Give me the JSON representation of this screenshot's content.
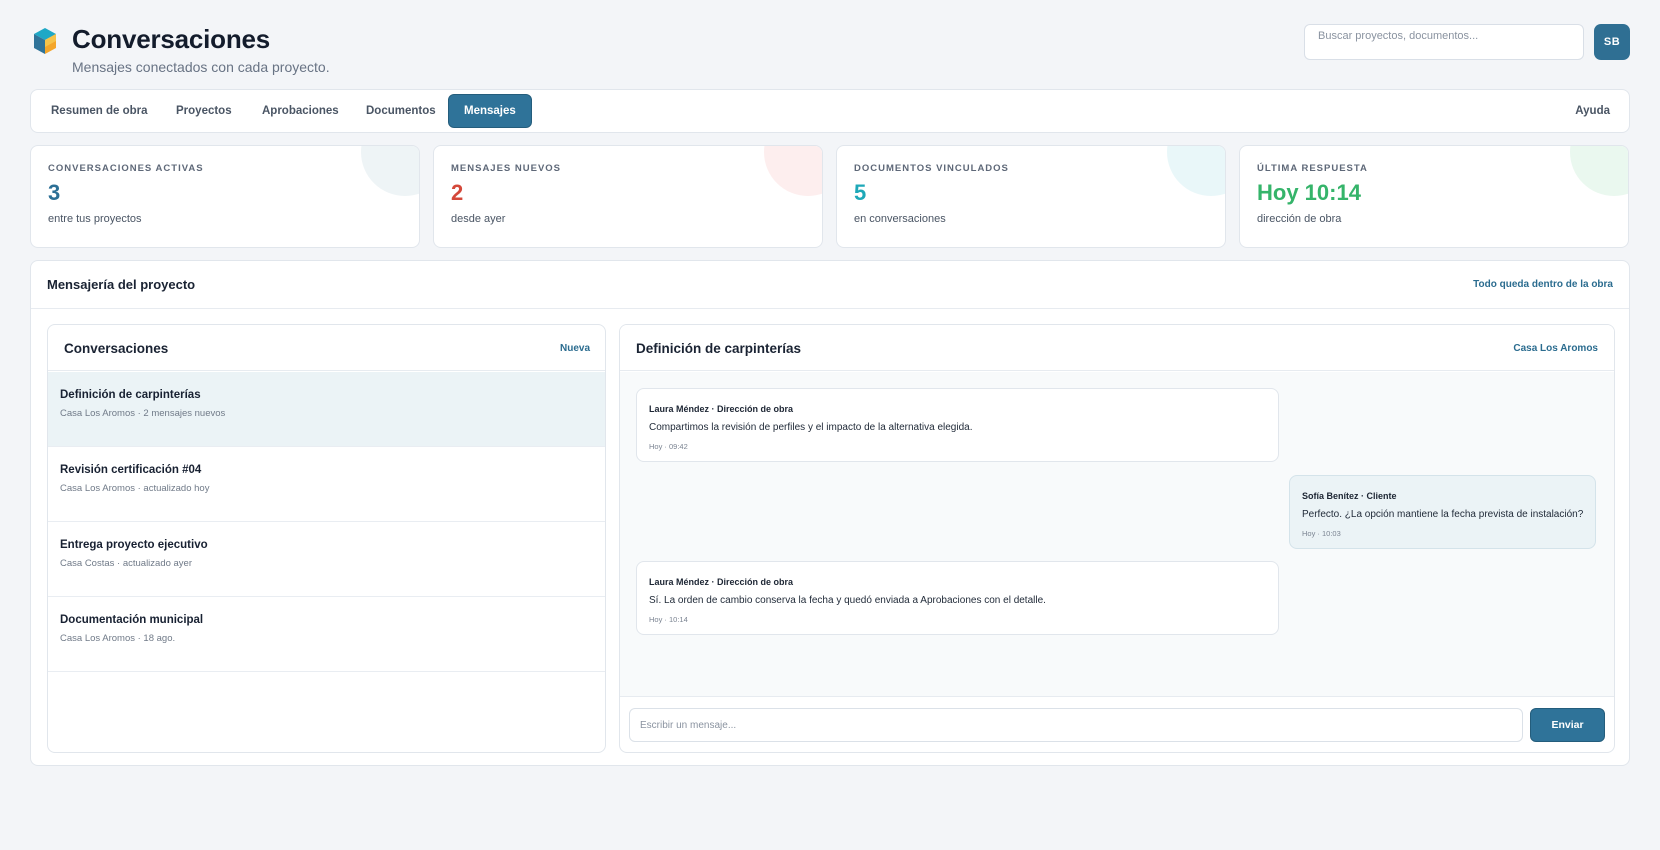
{
  "header": {
    "title": "Conversaciones",
    "subtitle": "Mensajes conectados con cada proyecto.",
    "search_placeholder": "Buscar proyectos, documentos...",
    "avatar_initials": "SB",
    "logo_icon": "cube-logo-icon"
  },
  "nav": {
    "tabs": [
      {
        "label": "Resumen de obra",
        "active": false
      },
      {
        "label": "Proyectos",
        "active": false
      },
      {
        "label": "Aprobaciones",
        "active": false
      },
      {
        "label": "Documentos",
        "active": false
      },
      {
        "label": "Mensajes",
        "active": true
      }
    ],
    "help": "Ayuda"
  },
  "stats": [
    {
      "label": "Conversaciones activas",
      "value": "3",
      "sub": "entre tus proyectos",
      "color": "#2c6f95",
      "deco": "#eef4f6"
    },
    {
      "label": "Mensajes nuevos",
      "value": "2",
      "sub": "desde ayer",
      "color": "#d4483a",
      "deco": "#fdeeee"
    },
    {
      "label": "Documentos vinculados",
      "value": "5",
      "sub": "en conversaciones",
      "color": "#1ea8b8",
      "deco": "#e9f7f9"
    },
    {
      "label": "Última respuesta",
      "value": "Hoy 10:14",
      "sub": "dirección de obra",
      "color": "#35b46a",
      "deco": "#eaf8ef"
    }
  ],
  "panel": {
    "title": "Mensajería del proyecto",
    "note": "Todo queda dentro de la obra"
  },
  "conversations": {
    "title": "Conversaciones",
    "new_label": "Nueva",
    "items": [
      {
        "title": "Definición de carpinterías",
        "meta": "Casa Los Aromos · 2 mensajes nuevos",
        "active": true
      },
      {
        "title": "Revisión certificación #04",
        "meta": "Casa Los Aromos · actualizado hoy",
        "active": false
      },
      {
        "title": "Entrega proyecto ejecutivo",
        "meta": "Casa Costas · actualizado ayer",
        "active": false
      },
      {
        "title": "Documentación municipal",
        "meta": "Casa Los Aromos · 18 ago.",
        "active": false
      }
    ]
  },
  "chat": {
    "title": "Definición de carpinterías",
    "project": "Casa Los Aromos",
    "messages": [
      {
        "author": "Laura Méndez · Dirección de obra",
        "text": "Compartimos la revisión de perfiles y el impacto de la alternativa elegida.",
        "time": "Hoy · 09:42",
        "from": "team"
      },
      {
        "author": "Sofía Benítez · Cliente",
        "text": "Perfecto. ¿La opción mantiene la fecha prevista de instalación?",
        "time": "Hoy · 10:03",
        "from": "client"
      },
      {
        "author": "Laura Méndez · Dirección de obra",
        "text": "Sí. La orden de cambio conserva la fecha y quedó enviada a Aprobaciones con el detalle.",
        "time": "Hoy · 10:14",
        "from": "team"
      }
    ],
    "input_placeholder": "Escribir un mensaje...",
    "send_label": "Enviar"
  }
}
